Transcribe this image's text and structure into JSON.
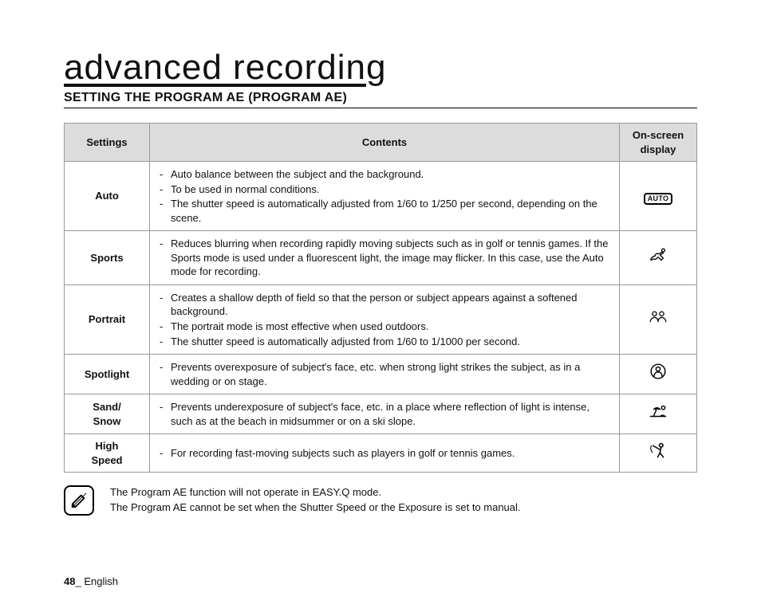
{
  "title": "advanced recording",
  "section_heading": "SETTING THE PROGRAM AE (PROGRAM AE)",
  "table": {
    "headers": {
      "settings": "Settings",
      "contents": "Contents",
      "display": "On-screen display"
    },
    "rows": {
      "auto": {
        "name": "Auto",
        "icon_label": "AUTO",
        "items": [
          "Auto balance between the subject and the background.",
          "To be used in normal conditions.",
          "The shutter speed is automatically adjusted from 1/60 to 1/250 per second, depending on the scene."
        ]
      },
      "sports": {
        "name": "Sports",
        "items": [
          "Reduces blurring when recording rapidly moving subjects such as in golf or tennis games. If the Sports mode is used under a fluorescent light, the image may flicker. In this case, use the Auto mode for recording."
        ]
      },
      "portrait": {
        "name": "Portrait",
        "items": [
          "Creates a shallow depth of field so that the person or subject appears against a softened background.",
          "The portrait mode is most effective when used outdoors.",
          "The shutter speed is automatically adjusted from 1/60 to 1/1000 per second."
        ]
      },
      "spotlight": {
        "name": "Spotlight",
        "items": [
          "Prevents overexposure of subject's face, etc. when strong light strikes the subject, as in a wedding or on stage."
        ]
      },
      "sandsnow": {
        "name": "Sand/\nSnow",
        "items": [
          "Prevents underexposure of subject's face, etc. in a place where reflection of light is intense, such as at the beach in midsummer or on a ski slope."
        ]
      },
      "highspeed": {
        "name": "High\nSpeed",
        "items": [
          "For recording fast-moving subjects such as players in golf or tennis games."
        ]
      }
    }
  },
  "notes": {
    "line1": "The Program AE function will not operate in EASY.Q mode.",
    "line2": "The Program AE cannot be set when the Shutter Speed or the Exposure is set to manual."
  },
  "footer": {
    "page": "48",
    "sep": "_ ",
    "lang": "English"
  }
}
